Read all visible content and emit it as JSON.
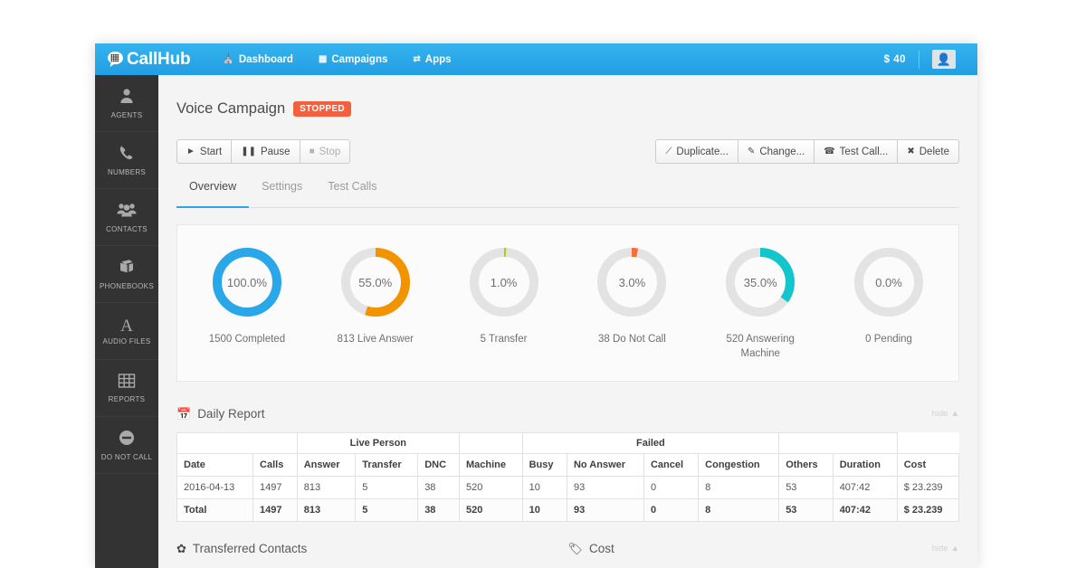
{
  "navbar": {
    "brand": "CallHub",
    "brand_icon": "speech-bubble-grid-icon",
    "links": [
      {
        "label": "Dashboard",
        "icon": "home-icon"
      },
      {
        "label": "Campaigns",
        "icon": "grid-icon"
      },
      {
        "label": "Apps",
        "icon": "shuffle-icon"
      }
    ],
    "credit": "$ 40",
    "avatar_icon": "user-avatar-icon"
  },
  "sidebar": {
    "items": [
      {
        "label": "AGENTS",
        "icon": "person-icon"
      },
      {
        "label": "NUMBERS",
        "icon": "phone-icon"
      },
      {
        "label": "CONTACTS",
        "icon": "people-group-icon"
      },
      {
        "label": "PHONEBOOKS",
        "icon": "book-icon"
      },
      {
        "label": "AUDIO FILES",
        "icon": "letter-a-icon"
      },
      {
        "label": "REPORTS",
        "icon": "table-grid-icon"
      },
      {
        "label": "DO NOT CALL",
        "icon": "minus-circle-icon"
      }
    ]
  },
  "page": {
    "title": "Voice Campaign",
    "status": "STOPPED",
    "status_color": "#f4603e"
  },
  "controls": {
    "left": [
      {
        "label": "Start",
        "icon": "play-icon",
        "disabled": false
      },
      {
        "label": "Pause",
        "icon": "pause-icon",
        "disabled": false
      },
      {
        "label": "Stop",
        "icon": "stop-icon",
        "disabled": true
      }
    ],
    "right": [
      {
        "label": "Duplicate...",
        "icon": "copy-icon"
      },
      {
        "label": "Change...",
        "icon": "edit-icon"
      },
      {
        "label": "Test Call...",
        "icon": "phone-icon"
      },
      {
        "label": "Delete",
        "icon": "close-x-icon"
      }
    ]
  },
  "tabs": [
    {
      "label": "Overview",
      "active": true
    },
    {
      "label": "Settings",
      "active": false
    },
    {
      "label": "Test Calls",
      "active": false
    }
  ],
  "chart_data": {
    "type": "pie",
    "title": "Campaign Call Outcome Donuts",
    "donuts": [
      {
        "percent": 100.0,
        "percent_label": "100.0%",
        "caption": "1500 Completed",
        "count": 1500,
        "name": "Completed",
        "color": "#29a7e8"
      },
      {
        "percent": 55.0,
        "percent_label": "55.0%",
        "caption": "813 Live Answer",
        "count": 813,
        "name": "Live Answer",
        "color": "#f29400"
      },
      {
        "percent": 1.0,
        "percent_label": "1.0%",
        "caption": "5 Transfer",
        "count": 5,
        "name": "Transfer",
        "color": "#a8d010"
      },
      {
        "percent": 3.0,
        "percent_label": "3.0%",
        "caption": "38 Do Not Call",
        "count": 38,
        "name": "Do Not Call",
        "color": "#fa6e35"
      },
      {
        "percent": 35.0,
        "percent_label": "35.0%",
        "caption": "520 Answering Machine",
        "count": 520,
        "name": "Answering Machine",
        "color": "#13c6cd"
      },
      {
        "percent": 0.0,
        "percent_label": "0.0%",
        "caption": "0 Pending",
        "count": 0,
        "name": "Pending",
        "color": "#e3e3e3"
      }
    ],
    "track_color": "#e3e3e3"
  },
  "daily_report": {
    "title": "Daily Report",
    "icon": "calendar-icon",
    "hide_label": "hide",
    "group_headers": [
      {
        "label": "",
        "span": 2
      },
      {
        "label": "Live Person",
        "span": 3
      },
      {
        "label": "",
        "span": 1
      },
      {
        "label": "Failed",
        "span": 4
      },
      {
        "label": "",
        "span": 2
      }
    ],
    "columns": [
      "Date",
      "Calls",
      "Answer",
      "Transfer",
      "DNC",
      "Machine",
      "Busy",
      "No Answer",
      "Cancel",
      "Congestion",
      "Others",
      "Duration",
      "Cost"
    ],
    "rows": [
      [
        "2016-04-13",
        "1497",
        "813",
        "5",
        "38",
        "520",
        "10",
        "93",
        "0",
        "8",
        "53",
        "407:42",
        "$ 23.239"
      ]
    ],
    "total_row": [
      "Total",
      "1497",
      "813",
      "5",
      "38",
      "520",
      "10",
      "93",
      "0",
      "8",
      "53",
      "407:42",
      "$ 23.239"
    ]
  },
  "bottom_sections": [
    {
      "title": "Transferred Contacts",
      "icon": "leaf-icon",
      "hide_label": ""
    },
    {
      "title": "Cost",
      "icon": "tag-icon",
      "hide_label": "hide"
    }
  ]
}
